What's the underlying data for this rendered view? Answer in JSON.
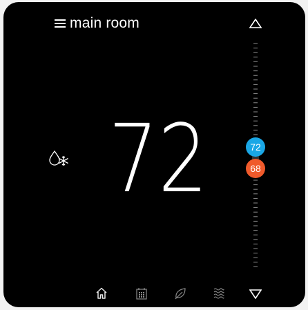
{
  "header": {
    "room_name": "main room",
    "menu_icon": "hamburger-menu-icon"
  },
  "display": {
    "current_temperature": "72",
    "mode_icon": "heat-cool-mode-icon"
  },
  "setpoints": {
    "cool": "72",
    "heat": "68",
    "cool_color": "#1aa7e6",
    "heat_color": "#f05a2b"
  },
  "controls": {
    "up_icon": "triangle-up-icon",
    "down_icon": "triangle-down-icon"
  },
  "nav": {
    "items": [
      {
        "icon": "home-icon",
        "active": true
      },
      {
        "icon": "schedule-calendar-icon",
        "active": false
      },
      {
        "icon": "eco-leaf-icon",
        "active": false
      },
      {
        "icon": "humidity-waves-icon",
        "active": false
      }
    ]
  },
  "colors": {
    "background": "#000000",
    "text": "#ffffff",
    "nav_active": "#e8e8e8",
    "nav_inactive": "#8a8a8a"
  }
}
